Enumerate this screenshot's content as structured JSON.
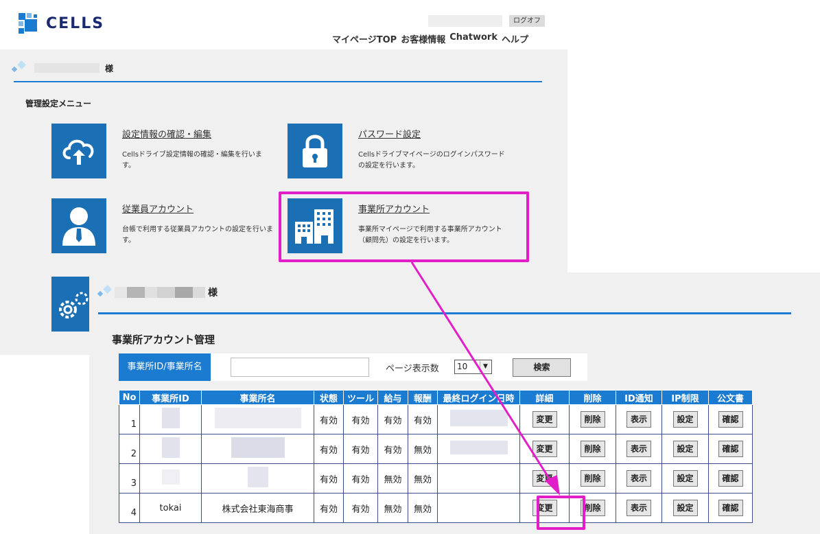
{
  "app": {
    "brand": "CELLS",
    "logoff": "ログオフ"
  },
  "nav": {
    "items": [
      "マイページTOP",
      "お客様情報",
      "Chatwork",
      "ヘルプ"
    ]
  },
  "back": {
    "honorific": "様",
    "menu_title": "管理設定メニュー",
    "cards": [
      {
        "title": "設定情報の確認・編集",
        "desc": "Cellsドライブ設定情報の確認・編集を行います。",
        "icon": "cloud-upload-icon"
      },
      {
        "title": "パスワード設定",
        "desc": "Cellsドライブマイページのログインパスワードの設定を行います。",
        "icon": "lock-icon"
      },
      {
        "title": "従業員アカウント",
        "desc": "台帳で利用する従業員アカウントの設定を行います。",
        "icon": "person-icon"
      },
      {
        "title": "事業所アカウント",
        "desc": "事業所マイページで利用する事業所アカウント（顧問先）の設定を行います。",
        "icon": "building-icon"
      },
      {
        "title": "",
        "desc": "",
        "icon": "gears-icon"
      }
    ]
  },
  "front": {
    "honorific": "様",
    "section_title": "事業所アカウント管理",
    "search": {
      "label": "事業所ID/事業所名",
      "value": "",
      "page_label": "ページ表示数",
      "page_size": "10",
      "button": "検索"
    },
    "table": {
      "headers": [
        "No",
        "事業所ID",
        "事業所名",
        "状態",
        "ツール",
        "給与",
        "報酬",
        "最終ログイン日時",
        "詳細",
        "削除",
        "ID通知",
        "IP制限",
        "公文書"
      ],
      "buttons": {
        "detail": "変更",
        "delete": "削除",
        "id": "表示",
        "ip": "設定",
        "doc": "確認"
      },
      "rows": [
        {
          "no": "1",
          "id": "",
          "name": "",
          "status": "有効",
          "tool": "有効",
          "salary": "有効",
          "reward": "有効",
          "last_login": ""
        },
        {
          "no": "2",
          "id": "",
          "name": "",
          "status": "有効",
          "tool": "有効",
          "salary": "有効",
          "reward": "無効",
          "last_login": ""
        },
        {
          "no": "3",
          "id": "",
          "name": "",
          "status": "有効",
          "tool": "有効",
          "salary": "無効",
          "reward": "無効",
          "last_login": ""
        },
        {
          "no": "4",
          "id": "tokai",
          "name": "株式会社東海商事",
          "status": "有効",
          "tool": "有効",
          "salary": "無効",
          "reward": "無効",
          "last_login": ""
        }
      ]
    }
  },
  "colors": {
    "accent": "#1a7bd0",
    "highlight": "#e21ec8",
    "panel": "#f0f0f0"
  }
}
